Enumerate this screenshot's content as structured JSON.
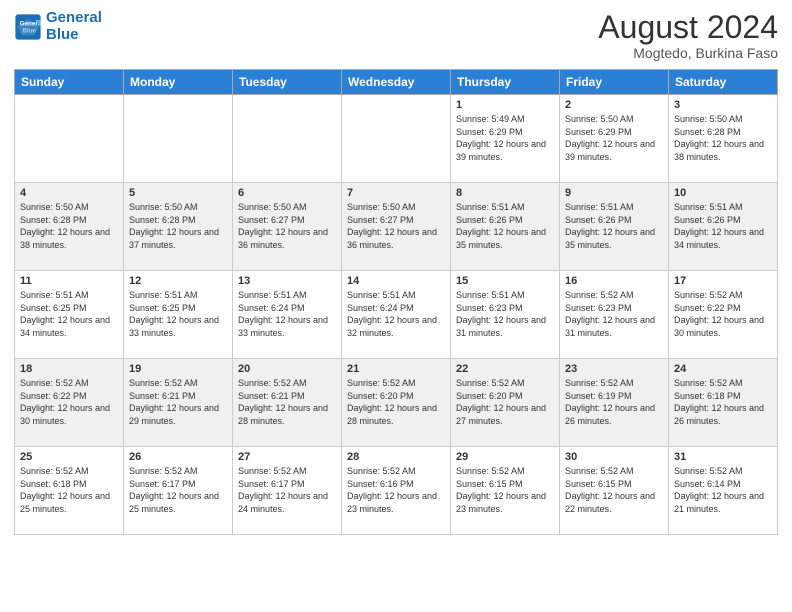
{
  "logo": {
    "line1": "General",
    "line2": "Blue"
  },
  "title": "August 2024",
  "subtitle": "Mogtedo, Burkina Faso",
  "days_of_week": [
    "Sunday",
    "Monday",
    "Tuesday",
    "Wednesday",
    "Thursday",
    "Friday",
    "Saturday"
  ],
  "weeks": [
    [
      {
        "day": "",
        "info": ""
      },
      {
        "day": "",
        "info": ""
      },
      {
        "day": "",
        "info": ""
      },
      {
        "day": "",
        "info": ""
      },
      {
        "day": "1",
        "info": "Sunrise: 5:49 AM\nSunset: 6:29 PM\nDaylight: 12 hours\nand 39 minutes."
      },
      {
        "day": "2",
        "info": "Sunrise: 5:50 AM\nSunset: 6:29 PM\nDaylight: 12 hours\nand 39 minutes."
      },
      {
        "day": "3",
        "info": "Sunrise: 5:50 AM\nSunset: 6:28 PM\nDaylight: 12 hours\nand 38 minutes."
      }
    ],
    [
      {
        "day": "4",
        "info": "Sunrise: 5:50 AM\nSunset: 6:28 PM\nDaylight: 12 hours\nand 38 minutes."
      },
      {
        "day": "5",
        "info": "Sunrise: 5:50 AM\nSunset: 6:28 PM\nDaylight: 12 hours\nand 37 minutes."
      },
      {
        "day": "6",
        "info": "Sunrise: 5:50 AM\nSunset: 6:27 PM\nDaylight: 12 hours\nand 36 minutes."
      },
      {
        "day": "7",
        "info": "Sunrise: 5:50 AM\nSunset: 6:27 PM\nDaylight: 12 hours\nand 36 minutes."
      },
      {
        "day": "8",
        "info": "Sunrise: 5:51 AM\nSunset: 6:26 PM\nDaylight: 12 hours\nand 35 minutes."
      },
      {
        "day": "9",
        "info": "Sunrise: 5:51 AM\nSunset: 6:26 PM\nDaylight: 12 hours\nand 35 minutes."
      },
      {
        "day": "10",
        "info": "Sunrise: 5:51 AM\nSunset: 6:26 PM\nDaylight: 12 hours\nand 34 minutes."
      }
    ],
    [
      {
        "day": "11",
        "info": "Sunrise: 5:51 AM\nSunset: 6:25 PM\nDaylight: 12 hours\nand 34 minutes."
      },
      {
        "day": "12",
        "info": "Sunrise: 5:51 AM\nSunset: 6:25 PM\nDaylight: 12 hours\nand 33 minutes."
      },
      {
        "day": "13",
        "info": "Sunrise: 5:51 AM\nSunset: 6:24 PM\nDaylight: 12 hours\nand 33 minutes."
      },
      {
        "day": "14",
        "info": "Sunrise: 5:51 AM\nSunset: 6:24 PM\nDaylight: 12 hours\nand 32 minutes."
      },
      {
        "day": "15",
        "info": "Sunrise: 5:51 AM\nSunset: 6:23 PM\nDaylight: 12 hours\nand 31 minutes."
      },
      {
        "day": "16",
        "info": "Sunrise: 5:52 AM\nSunset: 6:23 PM\nDaylight: 12 hours\nand 31 minutes."
      },
      {
        "day": "17",
        "info": "Sunrise: 5:52 AM\nSunset: 6:22 PM\nDaylight: 12 hours\nand 30 minutes."
      }
    ],
    [
      {
        "day": "18",
        "info": "Sunrise: 5:52 AM\nSunset: 6:22 PM\nDaylight: 12 hours\nand 30 minutes."
      },
      {
        "day": "19",
        "info": "Sunrise: 5:52 AM\nSunset: 6:21 PM\nDaylight: 12 hours\nand 29 minutes."
      },
      {
        "day": "20",
        "info": "Sunrise: 5:52 AM\nSunset: 6:21 PM\nDaylight: 12 hours\nand 28 minutes."
      },
      {
        "day": "21",
        "info": "Sunrise: 5:52 AM\nSunset: 6:20 PM\nDaylight: 12 hours\nand 28 minutes."
      },
      {
        "day": "22",
        "info": "Sunrise: 5:52 AM\nSunset: 6:20 PM\nDaylight: 12 hours\nand 27 minutes."
      },
      {
        "day": "23",
        "info": "Sunrise: 5:52 AM\nSunset: 6:19 PM\nDaylight: 12 hours\nand 26 minutes."
      },
      {
        "day": "24",
        "info": "Sunrise: 5:52 AM\nSunset: 6:18 PM\nDaylight: 12 hours\nand 26 minutes."
      }
    ],
    [
      {
        "day": "25",
        "info": "Sunrise: 5:52 AM\nSunset: 6:18 PM\nDaylight: 12 hours\nand 25 minutes."
      },
      {
        "day": "26",
        "info": "Sunrise: 5:52 AM\nSunset: 6:17 PM\nDaylight: 12 hours\nand 25 minutes."
      },
      {
        "day": "27",
        "info": "Sunrise: 5:52 AM\nSunset: 6:17 PM\nDaylight: 12 hours\nand 24 minutes."
      },
      {
        "day": "28",
        "info": "Sunrise: 5:52 AM\nSunset: 6:16 PM\nDaylight: 12 hours\nand 23 minutes."
      },
      {
        "day": "29",
        "info": "Sunrise: 5:52 AM\nSunset: 6:15 PM\nDaylight: 12 hours\nand 23 minutes."
      },
      {
        "day": "30",
        "info": "Sunrise: 5:52 AM\nSunset: 6:15 PM\nDaylight: 12 hours\nand 22 minutes."
      },
      {
        "day": "31",
        "info": "Sunrise: 5:52 AM\nSunset: 6:14 PM\nDaylight: 12 hours\nand 21 minutes."
      }
    ]
  ]
}
